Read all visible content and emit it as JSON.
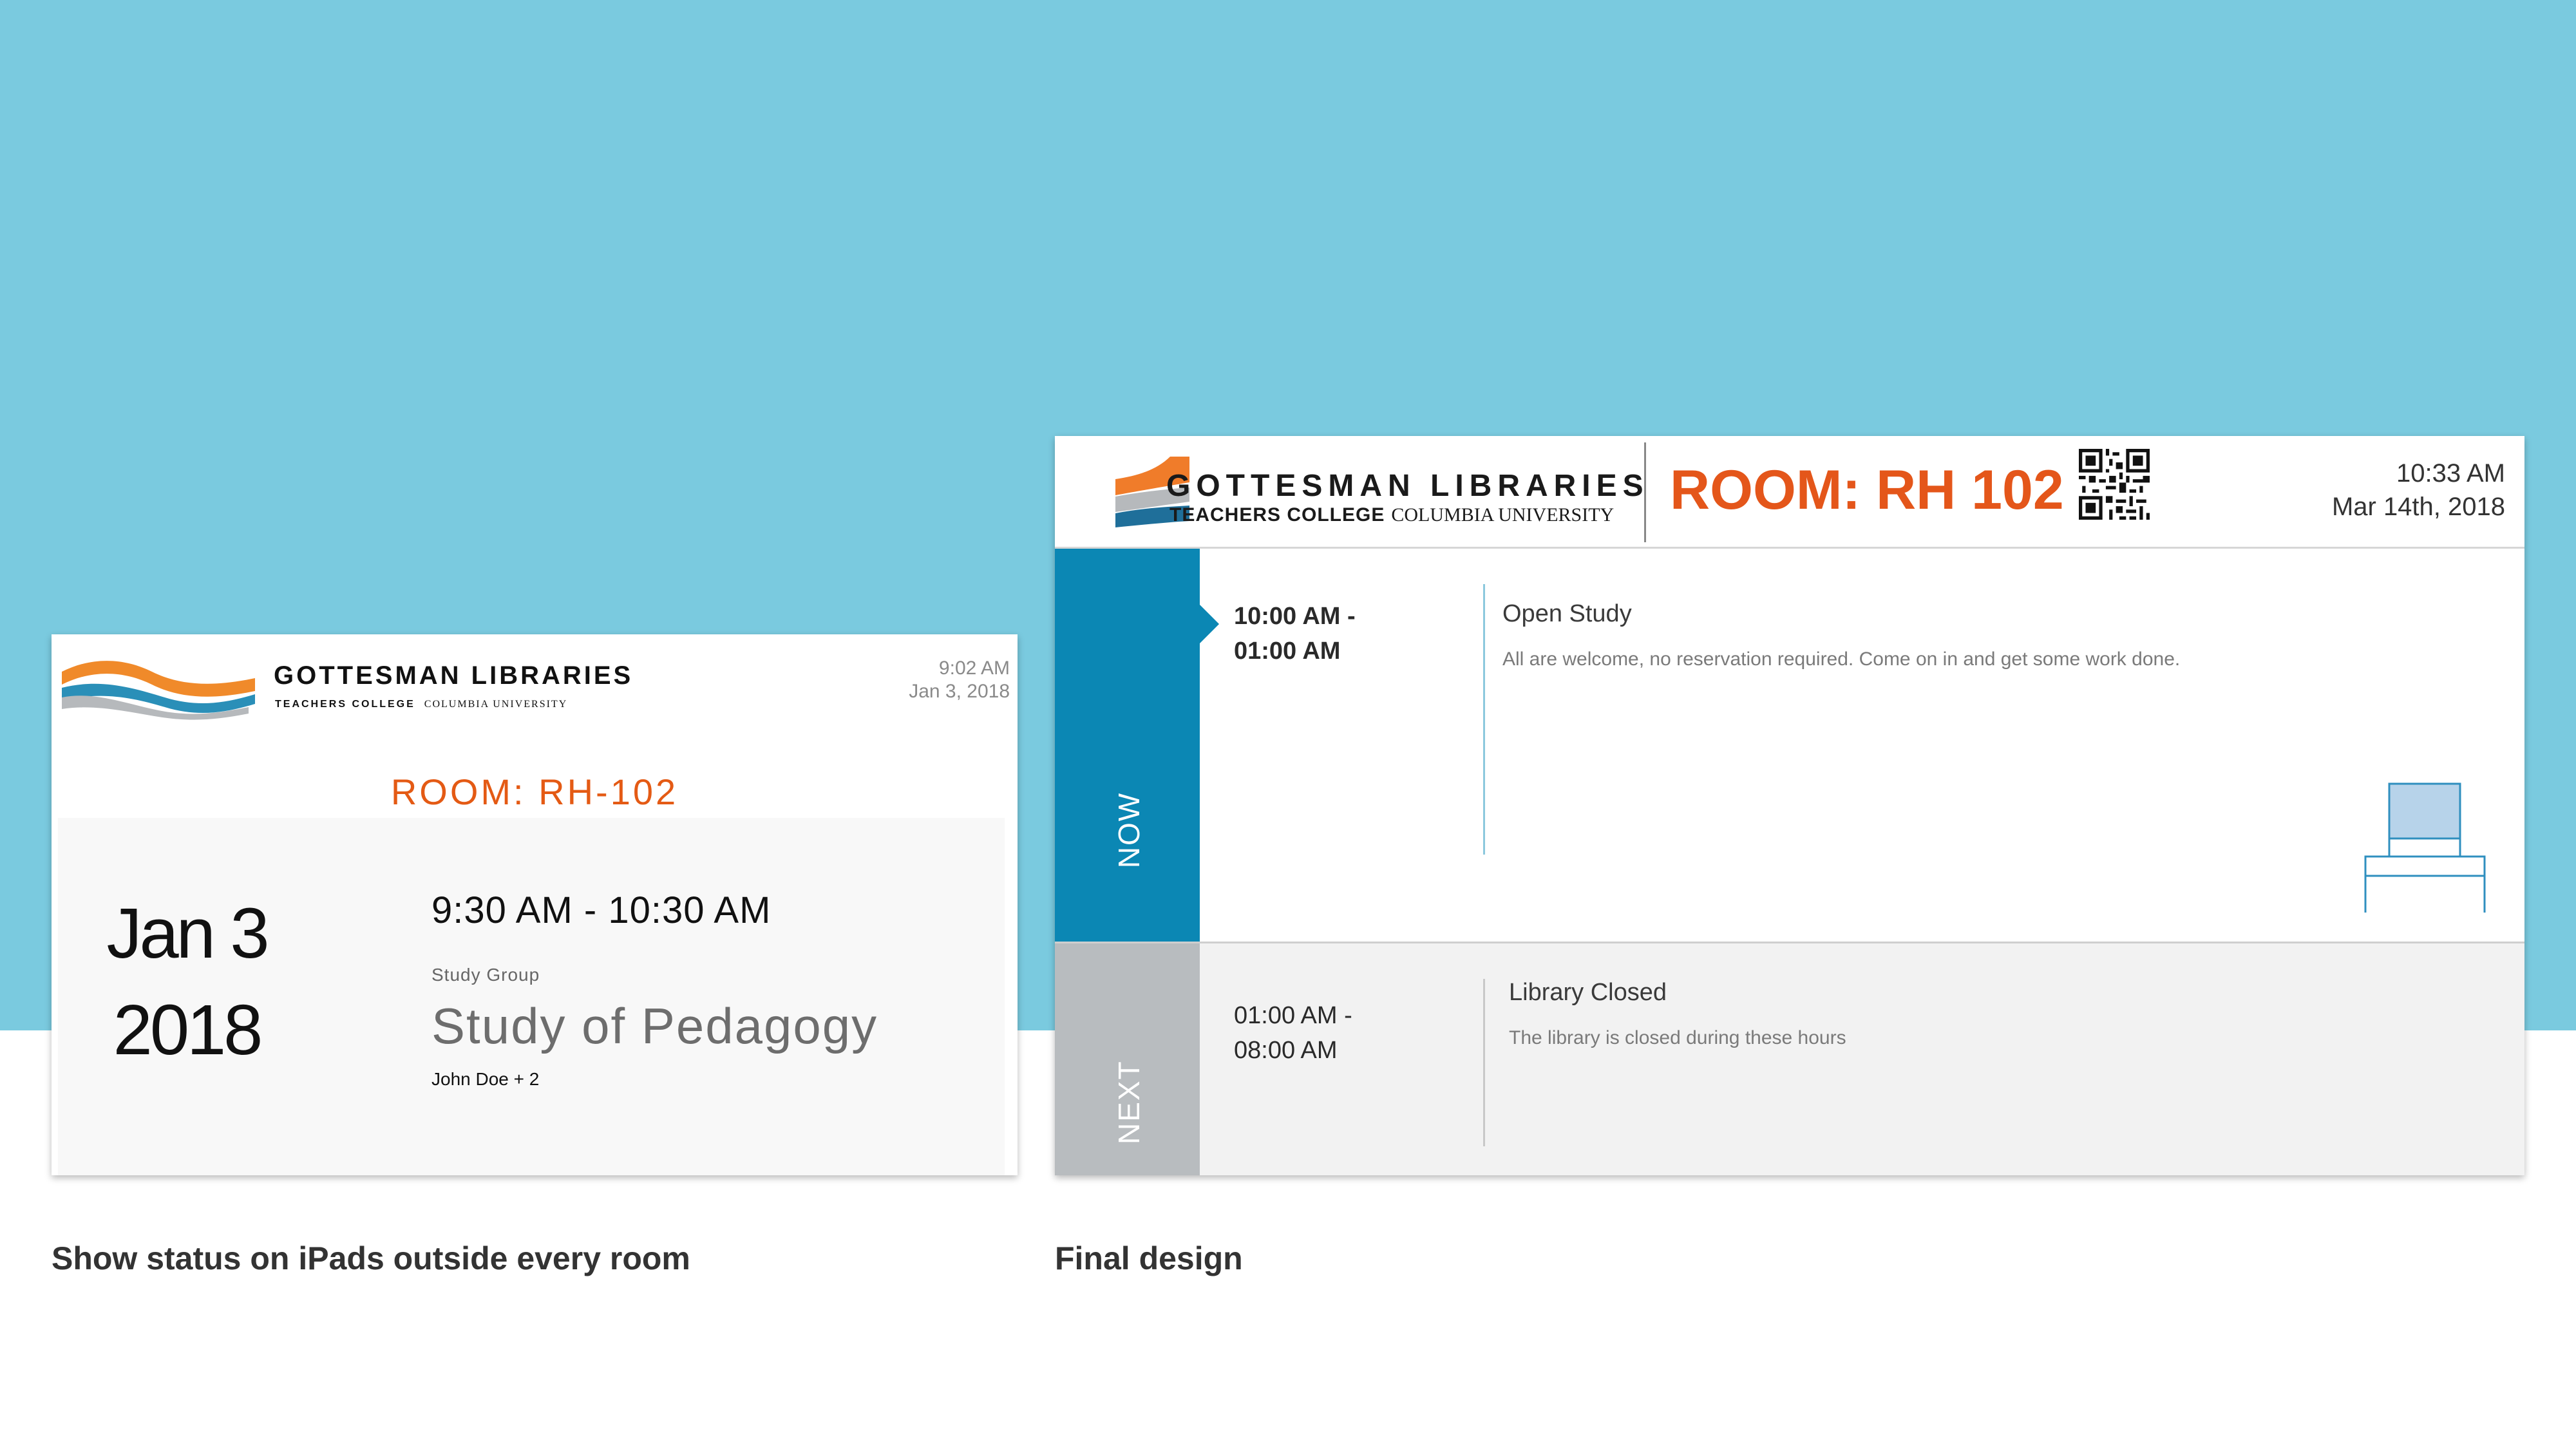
{
  "early_design": {
    "brand": "GOTTESMAN LIBRARIES",
    "sub_bold": "TEACHERS COLLEGE",
    "sub_serif": "COLUMBIA UNIVERSITY",
    "time": "9:02 AM",
    "date": "Jan 3, 2018",
    "room": "ROOM: RH-102",
    "big_date_line1": "Jan 3",
    "big_date_line2": "2018",
    "slot": "9:30 AM - 10:30 AM",
    "event_type": "Study Group",
    "event_title": "Study of Pedagogy",
    "people": "John Doe + 2",
    "caption": "Show status on iPads outside every room"
  },
  "final_design": {
    "brand": "GOTTESMAN LIBRARIES",
    "sub_bold": "TEACHERS COLLEGE",
    "sub_serif": "COLUMBIA UNIVERSITY",
    "room": "ROOM: RH 102",
    "time": "10:33 AM",
    "date": "Mar 14th, 2018",
    "now": {
      "label": "NOW",
      "slot_start": "10:00 AM -",
      "slot_end": "01:00 AM",
      "title": "Open Study",
      "description": "All are welcome, no reservation required. Come on in and get some work done."
    },
    "next": {
      "label": "NEXT",
      "slot_start": "01:00 AM -",
      "slot_end": "08:00 AM",
      "title": "Library Closed",
      "description": "The library is closed during these hours"
    },
    "caption": "Final design"
  },
  "colors": {
    "background_band": "#7acadf",
    "accent_orange": "#e4561a",
    "now_blue": "#0b87b4",
    "next_grey": "#b8bcbf"
  },
  "icons": [
    "library-logo-icon",
    "qr-code-icon",
    "chair-icon"
  ]
}
